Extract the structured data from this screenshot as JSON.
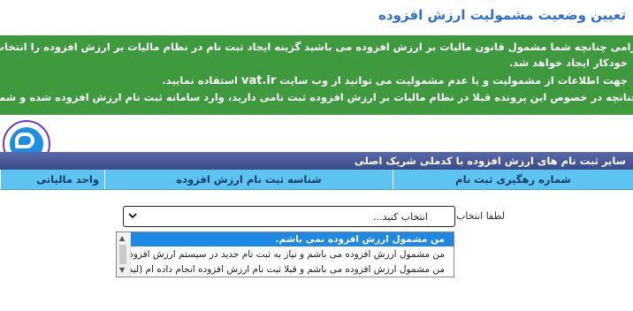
{
  "page": {
    "title": "تعیین وضعیت مشمولیت ارزش افزوده"
  },
  "notice": {
    "line1": "مودی گرامی چنانچه شما مشمول قانون مالیات بر ارزش افزوده می باشید گزینه ایجاد ثبت نام در نظام مالیات بر ارزش افزوده را انتخاب نمایید. در این صورت",
    "line2": "خودکار ایجاد خواهد شد.",
    "line3_before": "جهت اطلاعات از مشمولیت و یا عدم مشمولیت می توانید از وب سایت",
    "line3_link": "vat.ir",
    "line3_after": "استفاده نمایید.",
    "line4": "چنانچه در خصوص این پرونده قبلا در نظام مالیات بر ارزش افزوده ثبت نامی دارید، وارد سامانه ثبت نام ارزش افزوده شده و شماره رهگیری این ثبت نام را آنجا ثبت نمایید"
  },
  "section": {
    "title": "سایر ثبت نام های ارزش افزوده با کدملی شریک اصلی"
  },
  "table": {
    "columns": [
      "شماره رهگیری ثبت نام",
      "شناسه ثبت نام ارزش افزوده",
      "واحد مالیاتی"
    ]
  },
  "form": {
    "prompt_label": "لطفا انتخاب نمایید:",
    "select_value": "انتخاب کنید...",
    "options": [
      "من مشمول ارزش افزوده نمی باشم.",
      "من مشمول ارزش افزوده می باشم و نیاز به ثبت نام جدید در سیستم ارزش افزوده دارم.",
      "من مشمول ارزش افزوده می باشم و قبلا ثبت نام ارزش افزوده انجام داده ام (لیست فوق)."
    ],
    "highlighted_index": 0
  },
  "colors": {
    "title": "#2f6fd0",
    "notice_bg": "#3f9a3f",
    "section_bg": "#3b4a88",
    "column_bg": "#5dc3f0",
    "highlight": "#1e88e5"
  }
}
